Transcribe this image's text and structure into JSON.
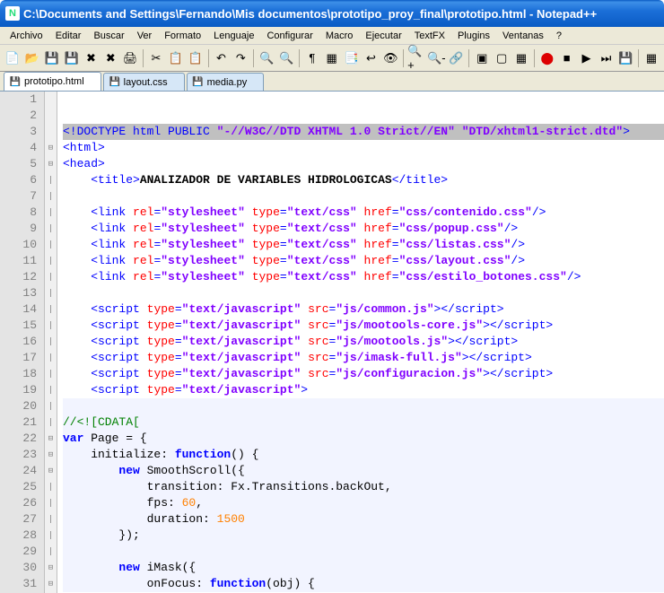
{
  "window": {
    "title": "C:\\Documents and Settings\\Fernando\\Mis documentos\\prototipo_proy_final\\prototipo.html - Notepad++"
  },
  "menu": {
    "items": [
      "Archivo",
      "Editar",
      "Buscar",
      "Ver",
      "Formato",
      "Lenguaje",
      "Configurar",
      "Macro",
      "Ejecutar",
      "TextFX",
      "Plugins",
      "Ventanas",
      "?"
    ]
  },
  "tabs": [
    {
      "name": "prototipo.html",
      "active": true,
      "icon_color": "#d22"
    },
    {
      "name": "layout.css",
      "active": false,
      "icon_color": "#39c"
    },
    {
      "name": "media.py",
      "active": false,
      "icon_color": "#39c"
    }
  ],
  "chart_data": null,
  "lines": [
    {
      "n": 1,
      "fold": "",
      "t": []
    },
    {
      "n": 2,
      "fold": "",
      "t": []
    },
    {
      "n": 3,
      "fold": "",
      "sel": true,
      "t": [
        {
          "c": "s-tag",
          "v": "<!DOCTYPE html PUBLIC "
        },
        {
          "c": "s-str",
          "v": "\"-//W3C//DTD XHTML 1.0 Strict//EN\""
        },
        {
          "c": "s-tag",
          "v": " "
        },
        {
          "c": "s-str",
          "v": "\"DTD/xhtml1-strict.dtd\""
        },
        {
          "c": "s-tag",
          "v": ">"
        }
      ]
    },
    {
      "n": 4,
      "fold": "⊟",
      "t": [
        {
          "c": "s-tag",
          "v": "<html>"
        }
      ]
    },
    {
      "n": 5,
      "fold": "⊟",
      "t": [
        {
          "c": "s-tag",
          "v": "<head>"
        }
      ]
    },
    {
      "n": 6,
      "fold": "|",
      "t": [
        {
          "c": "",
          "v": "    "
        },
        {
          "c": "s-tag",
          "v": "<title>"
        },
        {
          "c": "s-text",
          "v": "ANALIZADOR DE VARIABLES HIDROLOGICAS"
        },
        {
          "c": "s-tag",
          "v": "</title>"
        }
      ]
    },
    {
      "n": 7,
      "fold": "|",
      "t": []
    },
    {
      "n": 8,
      "fold": "|",
      "t": [
        {
          "c": "",
          "v": "    "
        },
        {
          "c": "s-tag",
          "v": "<link "
        },
        {
          "c": "s-attr",
          "v": "rel"
        },
        {
          "c": "s-tag",
          "v": "="
        },
        {
          "c": "s-str",
          "v": "\"stylesheet\""
        },
        {
          "c": "s-tag",
          "v": " "
        },
        {
          "c": "s-attr",
          "v": "type"
        },
        {
          "c": "s-tag",
          "v": "="
        },
        {
          "c": "s-str",
          "v": "\"text/css\""
        },
        {
          "c": "s-tag",
          "v": " "
        },
        {
          "c": "s-attr",
          "v": "href"
        },
        {
          "c": "s-tag",
          "v": "="
        },
        {
          "c": "s-str",
          "v": "\"css/contenido.css\""
        },
        {
          "c": "s-tag",
          "v": "/>"
        }
      ]
    },
    {
      "n": 9,
      "fold": "|",
      "t": [
        {
          "c": "",
          "v": "    "
        },
        {
          "c": "s-tag",
          "v": "<link "
        },
        {
          "c": "s-attr",
          "v": "rel"
        },
        {
          "c": "s-tag",
          "v": "="
        },
        {
          "c": "s-str",
          "v": "\"stylesheet\""
        },
        {
          "c": "s-tag",
          "v": " "
        },
        {
          "c": "s-attr",
          "v": "type"
        },
        {
          "c": "s-tag",
          "v": "="
        },
        {
          "c": "s-str",
          "v": "\"text/css\""
        },
        {
          "c": "s-tag",
          "v": " "
        },
        {
          "c": "s-attr",
          "v": "href"
        },
        {
          "c": "s-tag",
          "v": "="
        },
        {
          "c": "s-str",
          "v": "\"css/popup.css\""
        },
        {
          "c": "s-tag",
          "v": "/>"
        }
      ]
    },
    {
      "n": 10,
      "fold": "|",
      "t": [
        {
          "c": "",
          "v": "    "
        },
        {
          "c": "s-tag",
          "v": "<link "
        },
        {
          "c": "s-attr",
          "v": "rel"
        },
        {
          "c": "s-tag",
          "v": "="
        },
        {
          "c": "s-str",
          "v": "\"stylesheet\""
        },
        {
          "c": "s-tag",
          "v": " "
        },
        {
          "c": "s-attr",
          "v": "type"
        },
        {
          "c": "s-tag",
          "v": "="
        },
        {
          "c": "s-str",
          "v": "\"text/css\""
        },
        {
          "c": "s-tag",
          "v": " "
        },
        {
          "c": "s-attr",
          "v": "href"
        },
        {
          "c": "s-tag",
          "v": "="
        },
        {
          "c": "s-str",
          "v": "\"css/listas.css\""
        },
        {
          "c": "s-tag",
          "v": "/>"
        }
      ]
    },
    {
      "n": 11,
      "fold": "|",
      "t": [
        {
          "c": "",
          "v": "    "
        },
        {
          "c": "s-tag",
          "v": "<link "
        },
        {
          "c": "s-attr",
          "v": "rel"
        },
        {
          "c": "s-tag",
          "v": "="
        },
        {
          "c": "s-str",
          "v": "\"stylesheet\""
        },
        {
          "c": "s-tag",
          "v": " "
        },
        {
          "c": "s-attr",
          "v": "type"
        },
        {
          "c": "s-tag",
          "v": "="
        },
        {
          "c": "s-str",
          "v": "\"text/css\""
        },
        {
          "c": "s-tag",
          "v": " "
        },
        {
          "c": "s-attr",
          "v": "href"
        },
        {
          "c": "s-tag",
          "v": "="
        },
        {
          "c": "s-str",
          "v": "\"css/layout.css\""
        },
        {
          "c": "s-tag",
          "v": "/>"
        }
      ]
    },
    {
      "n": 12,
      "fold": "|",
      "t": [
        {
          "c": "",
          "v": "    "
        },
        {
          "c": "s-tag",
          "v": "<link "
        },
        {
          "c": "s-attr",
          "v": "rel"
        },
        {
          "c": "s-tag",
          "v": "="
        },
        {
          "c": "s-str",
          "v": "\"stylesheet\""
        },
        {
          "c": "s-tag",
          "v": " "
        },
        {
          "c": "s-attr",
          "v": "type"
        },
        {
          "c": "s-tag",
          "v": "="
        },
        {
          "c": "s-str",
          "v": "\"text/css\""
        },
        {
          "c": "s-tag",
          "v": " "
        },
        {
          "c": "s-attr",
          "v": "href"
        },
        {
          "c": "s-tag",
          "v": "="
        },
        {
          "c": "s-str",
          "v": "\"css/estilo_botones.css\""
        },
        {
          "c": "s-tag",
          "v": "/>"
        }
      ]
    },
    {
      "n": 13,
      "fold": "|",
      "t": []
    },
    {
      "n": 14,
      "fold": "|",
      "t": [
        {
          "c": "",
          "v": "    "
        },
        {
          "c": "s-tag",
          "v": "<script "
        },
        {
          "c": "s-attr",
          "v": "type"
        },
        {
          "c": "s-tag",
          "v": "="
        },
        {
          "c": "s-str",
          "v": "\"text/javascript\""
        },
        {
          "c": "s-tag",
          "v": " "
        },
        {
          "c": "s-attr",
          "v": "src"
        },
        {
          "c": "s-tag",
          "v": "="
        },
        {
          "c": "s-str",
          "v": "\"js/common.js\""
        },
        {
          "c": "s-tag",
          "v": "></script>"
        }
      ]
    },
    {
      "n": 15,
      "fold": "|",
      "t": [
        {
          "c": "",
          "v": "    "
        },
        {
          "c": "s-tag",
          "v": "<script "
        },
        {
          "c": "s-attr",
          "v": "type"
        },
        {
          "c": "s-tag",
          "v": "="
        },
        {
          "c": "s-str",
          "v": "\"text/javascript\""
        },
        {
          "c": "s-tag",
          "v": " "
        },
        {
          "c": "s-attr",
          "v": "src"
        },
        {
          "c": "s-tag",
          "v": "="
        },
        {
          "c": "s-str",
          "v": "\"js/mootools-core.js\""
        },
        {
          "c": "s-tag",
          "v": "></script>"
        }
      ]
    },
    {
      "n": 16,
      "fold": "|",
      "t": [
        {
          "c": "",
          "v": "    "
        },
        {
          "c": "s-tag",
          "v": "<script "
        },
        {
          "c": "s-attr",
          "v": "type"
        },
        {
          "c": "s-tag",
          "v": "="
        },
        {
          "c": "s-str",
          "v": "\"text/javascript\""
        },
        {
          "c": "s-tag",
          "v": " "
        },
        {
          "c": "s-attr",
          "v": "src"
        },
        {
          "c": "s-tag",
          "v": "="
        },
        {
          "c": "s-str",
          "v": "\"js/mootools.js\""
        },
        {
          "c": "s-tag",
          "v": "></script>"
        }
      ]
    },
    {
      "n": 17,
      "fold": "|",
      "t": [
        {
          "c": "",
          "v": "    "
        },
        {
          "c": "s-tag",
          "v": "<script "
        },
        {
          "c": "s-attr",
          "v": "type"
        },
        {
          "c": "s-tag",
          "v": "="
        },
        {
          "c": "s-str",
          "v": "\"text/javascript\""
        },
        {
          "c": "s-tag",
          "v": " "
        },
        {
          "c": "s-attr",
          "v": "src"
        },
        {
          "c": "s-tag",
          "v": "="
        },
        {
          "c": "s-str",
          "v": "\"js/imask-full.js\""
        },
        {
          "c": "s-tag",
          "v": "></script>"
        }
      ]
    },
    {
      "n": 18,
      "fold": "|",
      "t": [
        {
          "c": "",
          "v": "    "
        },
        {
          "c": "s-tag",
          "v": "<script "
        },
        {
          "c": "s-attr",
          "v": "type"
        },
        {
          "c": "s-tag",
          "v": "="
        },
        {
          "c": "s-str",
          "v": "\"text/javascript\""
        },
        {
          "c": "s-tag",
          "v": " "
        },
        {
          "c": "s-attr",
          "v": "src"
        },
        {
          "c": "s-tag",
          "v": "="
        },
        {
          "c": "s-str",
          "v": "\"js/configuracion.js\""
        },
        {
          "c": "s-tag",
          "v": "></script>"
        }
      ]
    },
    {
      "n": 19,
      "fold": "|",
      "t": [
        {
          "c": "",
          "v": "    "
        },
        {
          "c": "s-tag",
          "v": "<script "
        },
        {
          "c": "s-attr",
          "v": "type"
        },
        {
          "c": "s-tag",
          "v": "="
        },
        {
          "c": "s-str",
          "v": "\"text/javascript\""
        },
        {
          "c": "s-tag",
          "v": ">"
        }
      ]
    },
    {
      "n": 20,
      "fold": "|",
      "t": [],
      "js": true
    },
    {
      "n": 21,
      "fold": "|",
      "js": true,
      "t": [
        {
          "c": "s-comment",
          "v": "//<![CDATA["
        }
      ]
    },
    {
      "n": 22,
      "fold": "⊟",
      "js": true,
      "t": [
        {
          "c": "s-kw",
          "v": "var"
        },
        {
          "c": "",
          "v": " Page = {"
        }
      ]
    },
    {
      "n": 23,
      "fold": "⊟",
      "js": true,
      "t": [
        {
          "c": "",
          "v": "    initialize: "
        },
        {
          "c": "s-kw",
          "v": "function"
        },
        {
          "c": "",
          "v": "() {"
        }
      ]
    },
    {
      "n": 24,
      "fold": "⊟",
      "js": true,
      "t": [
        {
          "c": "",
          "v": "        "
        },
        {
          "c": "s-kw",
          "v": "new"
        },
        {
          "c": "",
          "v": " SmoothScroll({"
        }
      ]
    },
    {
      "n": 25,
      "fold": "|",
      "js": true,
      "t": [
        {
          "c": "",
          "v": "            transition: Fx.Transitions.backOut,"
        }
      ]
    },
    {
      "n": 26,
      "fold": "|",
      "js": true,
      "t": [
        {
          "c": "",
          "v": "            fps: "
        },
        {
          "c": "s-num",
          "v": "60"
        },
        {
          "c": "",
          "v": ","
        }
      ]
    },
    {
      "n": 27,
      "fold": "|",
      "js": true,
      "t": [
        {
          "c": "",
          "v": "            duration: "
        },
        {
          "c": "s-num",
          "v": "1500"
        }
      ]
    },
    {
      "n": 28,
      "fold": "|",
      "js": true,
      "t": [
        {
          "c": "",
          "v": "        });"
        }
      ]
    },
    {
      "n": 29,
      "fold": "|",
      "js": true,
      "t": []
    },
    {
      "n": 30,
      "fold": "⊟",
      "js": true,
      "t": [
        {
          "c": "",
          "v": "        "
        },
        {
          "c": "s-kw",
          "v": "new"
        },
        {
          "c": "",
          "v": " iMask({"
        }
      ]
    },
    {
      "n": 31,
      "fold": "⊟",
      "js": true,
      "t": [
        {
          "c": "",
          "v": "            onFocus: "
        },
        {
          "c": "s-kw",
          "v": "function"
        },
        {
          "c": "",
          "v": "(obj) {"
        }
      ]
    }
  ],
  "toolbar_icons": [
    "new",
    "open",
    "save",
    "save-all",
    "close",
    "close-all",
    "print",
    "|",
    "cut",
    "copy",
    "paste",
    "|",
    "undo",
    "redo",
    "|",
    "find",
    "replace",
    "|",
    "ws",
    "guide",
    "udl",
    "wrap",
    "allchars",
    "|",
    "zoom-in",
    "zoom-out",
    "sync",
    "|",
    "fold",
    "unfold",
    "hide",
    "|",
    "rec",
    "stop",
    "play",
    "play-multi",
    "save-macro",
    "|",
    "toggle"
  ]
}
